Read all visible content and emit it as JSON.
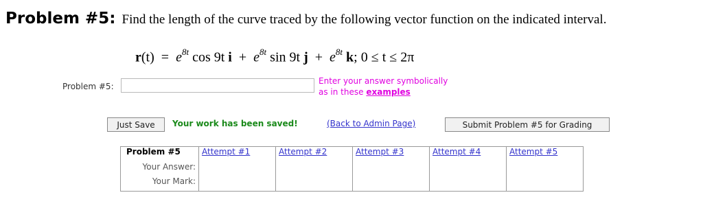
{
  "problem": {
    "number_label": "Problem #5:",
    "prompt": "Find the length of the curve traced by the following vector function on the indicated interval.",
    "formula": {
      "lhs": "r",
      "lhs_arg": "(t)",
      "eq": "=",
      "e1": "e",
      "exp1": "8t",
      "term1": "cos 9t",
      "i": "i",
      "plus1": "+",
      "e2": "e",
      "exp2": "8t",
      "term2": "sin 9t",
      "j": "j",
      "plus2": "+",
      "e3": "e",
      "exp3": "8t",
      "k": "k",
      "interval": "; 0 ≤ t ≤ 2π"
    }
  },
  "answer": {
    "label": "Problem #5:",
    "value": "",
    "placeholder": ""
  },
  "hint": {
    "line1": "Enter your answer symbolically",
    "line2_prefix": "as in these",
    "examples_link": "examples"
  },
  "actions": {
    "just_save": "Just Save",
    "saved_message": "Your work has been saved!",
    "admin_link": "(Back to Admin Page)",
    "submit": "Submit Problem #5 for Grading"
  },
  "attempts_table": {
    "title": "Problem #5",
    "row_labels": [
      "Your Answer:",
      "Your Mark:"
    ],
    "attempts": [
      "Attempt #1",
      "Attempt #2",
      "Attempt #3",
      "Attempt #4",
      "Attempt #5"
    ]
  },
  "colors": {
    "hint": "#e000e0",
    "saved": "#1b8a1b",
    "link": "#3333cc"
  }
}
